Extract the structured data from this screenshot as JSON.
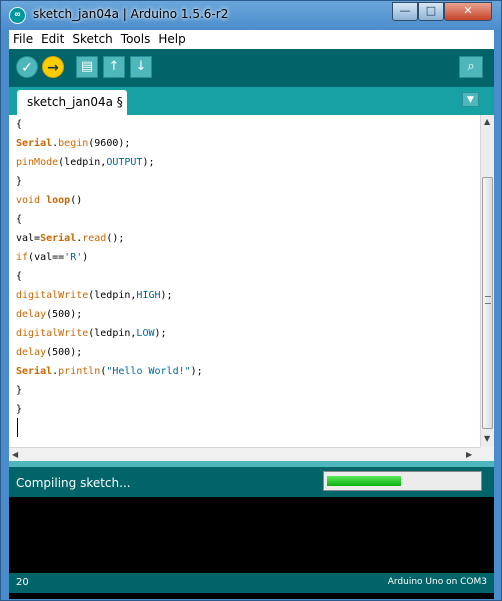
{
  "window": {
    "title": "sketch_jan04a | Arduino 1.5.6-r2",
    "minimize": "—",
    "maximize": "□",
    "close": "✕"
  },
  "app_icon": "arduino-logo-icon",
  "menu": [
    "File",
    "Edit",
    "Sketch",
    "Tools",
    "Help"
  ],
  "toolbar": {
    "verify_glyph": "✓",
    "upload_glyph": "→",
    "new_glyph": "▤",
    "open_glyph": "↑",
    "save_glyph": "↓",
    "serial_glyph": "⌕"
  },
  "tab": {
    "label": "sketch_jan04a §",
    "menu_glyph": "▼"
  },
  "code": [
    [
      {
        "t": "{"
      }
    ],
    [
      {
        "t": "Serial",
        "c": "kwb"
      },
      {
        "t": "."
      },
      {
        "t": "begin",
        "c": "kw"
      },
      {
        "t": "(9600);"
      }
    ],
    [
      {
        "t": "pinMode",
        "c": "kw"
      },
      {
        "t": "(ledpin,"
      },
      {
        "t": "OUTPUT",
        "c": "cst"
      },
      {
        "t": ");"
      }
    ],
    [
      {
        "t": "}"
      }
    ],
    [
      {
        "t": "void",
        "c": "kw"
      },
      {
        "t": " "
      },
      {
        "t": "loop",
        "c": "kwb"
      },
      {
        "t": "()"
      }
    ],
    [
      {
        "t": "{"
      }
    ],
    [
      {
        "t": "val="
      },
      {
        "t": "Serial",
        "c": "kwb"
      },
      {
        "t": "."
      },
      {
        "t": "read",
        "c": "kw"
      },
      {
        "t": "();"
      }
    ],
    [
      {
        "t": "if",
        "c": "kw"
      },
      {
        "t": "(val=="
      },
      {
        "t": "'R'",
        "c": "str"
      },
      {
        "t": ")"
      }
    ],
    [
      {
        "t": "{"
      }
    ],
    [
      {
        "t": "digitalWrite",
        "c": "kw"
      },
      {
        "t": "(ledpin,"
      },
      {
        "t": "HIGH",
        "c": "cst"
      },
      {
        "t": ");"
      }
    ],
    [
      {
        "t": "delay",
        "c": "kw"
      },
      {
        "t": "(500);"
      }
    ],
    [
      {
        "t": "digitalWrite",
        "c": "kw"
      },
      {
        "t": "(ledpin,"
      },
      {
        "t": "LOW",
        "c": "cst"
      },
      {
        "t": ");"
      }
    ],
    [
      {
        "t": "delay",
        "c": "kw"
      },
      {
        "t": "(500);"
      }
    ],
    [
      {
        "t": "Serial",
        "c": "kwb"
      },
      {
        "t": "."
      },
      {
        "t": "println",
        "c": "kw"
      },
      {
        "t": "("
      },
      {
        "t": "\"Hello World!\"",
        "c": "str"
      },
      {
        "t": ");"
      }
    ],
    [
      {
        "t": "}"
      }
    ],
    [
      {
        "t": "}"
      }
    ]
  ],
  "status": {
    "text": "Compiling sketch...",
    "progress": 0.49
  },
  "footer": {
    "line_number": "20",
    "board": "Arduino Uno on COM3"
  },
  "colors": {
    "teal_dark": "#006468",
    "teal": "#17a1a5",
    "accent_yellow": "#ffcc00",
    "keyword": "#cc6600",
    "constant": "#006699"
  }
}
